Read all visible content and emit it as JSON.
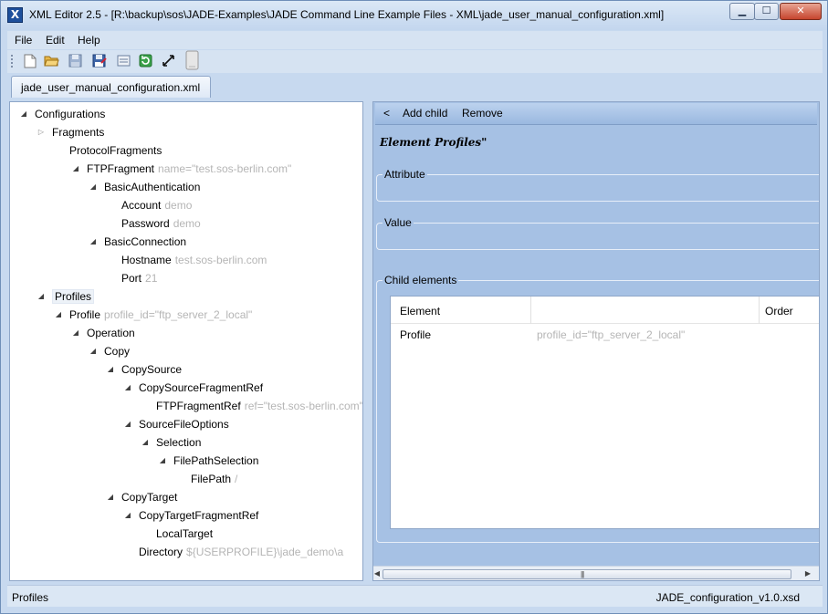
{
  "window": {
    "title": "XML Editor 2.5 - [R:\\backup\\sos\\JADE-Examples\\JADE Command Line Example Files - XML\\jade_user_manual_configuration.xml]",
    "minimize_label": "▁",
    "maximize_label": "☐",
    "close_label": "✕"
  },
  "menu": {
    "items": [
      "File",
      "Edit",
      "Help"
    ]
  },
  "toolbar": {
    "icons": [
      "new-file-icon",
      "open-folder-icon",
      "save-icon",
      "save-as-icon",
      "validate-icon",
      "refresh-icon",
      "expand-icon",
      "document-icon"
    ]
  },
  "tab": {
    "label": "jade_user_manual_configuration.xml"
  },
  "tree": {
    "nodes": [
      {
        "label": "Configurations",
        "attr": "",
        "state": "expanded"
      },
      {
        "label": "Fragments",
        "attr": "",
        "state": "collapsed"
      },
      {
        "label": "ProtocolFragments",
        "attr": "",
        "state": "none"
      },
      {
        "label": "FTPFragment",
        "attr": "name=\"test.sos-berlin.com\"",
        "state": "expanded"
      },
      {
        "label": "BasicAuthentication",
        "attr": "",
        "state": "expanded"
      },
      {
        "label": "Account",
        "attr": "demo",
        "state": "none"
      },
      {
        "label": "Password",
        "attr": "demo",
        "state": "none"
      },
      {
        "label": "BasicConnection",
        "attr": "",
        "state": "expanded"
      },
      {
        "label": "Hostname",
        "attr": "test.sos-berlin.com",
        "state": "none"
      },
      {
        "label": "Port",
        "attr": "21",
        "state": "none"
      },
      {
        "label": "Profiles",
        "attr": "",
        "state": "expanded"
      },
      {
        "label": "Profile",
        "attr": "profile_id=\"ftp_server_2_local\"",
        "state": "expanded"
      },
      {
        "label": "Operation",
        "attr": "",
        "state": "expanded"
      },
      {
        "label": "Copy",
        "attr": "",
        "state": "expanded"
      },
      {
        "label": "CopySource",
        "attr": "",
        "state": "expanded"
      },
      {
        "label": "CopySourceFragmentRef",
        "attr": "",
        "state": "expanded"
      },
      {
        "label": "FTPFragmentRef",
        "attr": "ref=\"test.sos-berlin.com\"",
        "state": "none"
      },
      {
        "label": "SourceFileOptions",
        "attr": "",
        "state": "expanded"
      },
      {
        "label": "Selection",
        "attr": "",
        "state": "expanded"
      },
      {
        "label": "FilePathSelection",
        "attr": "",
        "state": "expanded"
      },
      {
        "label": "FilePath",
        "attr": "/",
        "state": "none"
      },
      {
        "label": "CopyTarget",
        "attr": "",
        "state": "expanded"
      },
      {
        "label": "CopyTargetFragmentRef",
        "attr": "",
        "state": "expanded"
      },
      {
        "label": "LocalTarget",
        "attr": "",
        "state": "none"
      },
      {
        "label": "Directory",
        "attr": "${USERPROFILE}\\jade_demo\\a",
        "state": "none"
      }
    ]
  },
  "editor": {
    "back_label": "<",
    "add_child_label": "Add child",
    "remove_label": "Remove",
    "heading": "Element Profiles\"",
    "attribute_label": "Attribute",
    "value_label": "Value",
    "child_elements_label": "Child elements",
    "grid": {
      "headers": [
        "Element",
        "",
        "Order"
      ],
      "rows": [
        {
          "element": "Profile",
          "attr": "profile_id=\"ftp_server_2_local\"",
          "order": ""
        }
      ]
    },
    "scroll_grip": "|||"
  },
  "status": {
    "left": "Profiles",
    "right": "JADE_configuration_v1.0.xsd"
  }
}
